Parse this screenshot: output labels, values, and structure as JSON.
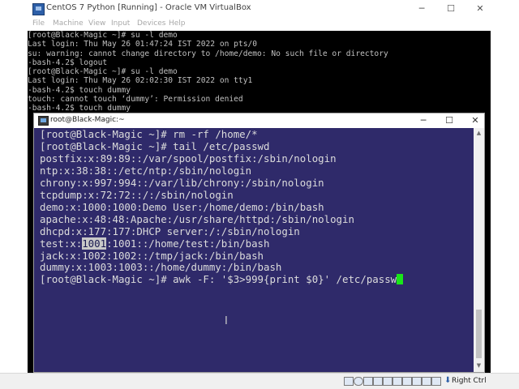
{
  "vbox": {
    "title": "CentOS 7 Python [Running] - Oracle VM VirtualBox",
    "controls": {
      "minimize": "─",
      "maximize": "☐",
      "close": "✕"
    },
    "menu": [
      "File",
      "Machine",
      "View",
      "Input",
      "Devices",
      "Help"
    ]
  },
  "console_text": "[root@Black-Magic ~]# su -l demo\nLast login: Thu May 26 01:47:24 IST 2022 on pts/0\nsu: warning: cannot change directory to /home/demo: No such file or directory\n-bash-4.2$ logout\n[root@Black-Magic ~]# su -l demo\nLast login: Thu May 26 02:02:30 IST 2022 on tty1\n-bash-4.2$ touch dummy\ntouch: cannot touch ‘dummy’: Permission denied\n-bash-4.2$ touch dummy",
  "terminal": {
    "title": "root@Black-Magic:~",
    "controls": {
      "minimize": "─",
      "maximize": "☐",
      "close": "✕"
    },
    "lines": [
      "[root@Black-Magic ~]# rm -rf /home/*",
      "[root@Black-Magic ~]# tail /etc/passwd",
      "postfix:x:89:89::/var/spool/postfix:/sbin/nologin",
      "ntp:x:38:38::/etc/ntp:/sbin/nologin",
      "chrony:x:997:994::/var/lib/chrony:/sbin/nologin",
      "tcpdump:x:72:72::/:/sbin/nologin",
      "demo:x:1000:1000:Demo User:/home/demo:/bin/bash",
      "apache:x:48:48:Apache:/usr/share/httpd:/sbin/nologin",
      "dhcpd:x:177:177:DHCP server:/:/sbin/nologin"
    ],
    "test_line": {
      "prefix": "test:x:",
      "highlight": "1001",
      "suffix": ":1001::/home/test:/bin/bash"
    },
    "lines_after": [
      "jack:x:1002:1002::/tmp/jack:/bin/bash",
      "dummy:x:1003:1003::/home/dummy:/bin/bash"
    ],
    "current_command": "[root@Black-Magic ~]# awk -F: '$3>999{print $0}' /etc/passw",
    "cursor_color": "#19e619",
    "background": "#2f2a6a"
  },
  "statusbar": {
    "icons": [
      "hard-disk-icon",
      "optical-drive-icon",
      "audio-icon",
      "network-icon",
      "usb-icon",
      "shared-folder-icon",
      "display-icon",
      "recording-icon",
      "guest-additions-icon",
      "mouse-integration-icon"
    ],
    "host_key_arrow": "⬇",
    "host_key": "Right Ctrl"
  }
}
